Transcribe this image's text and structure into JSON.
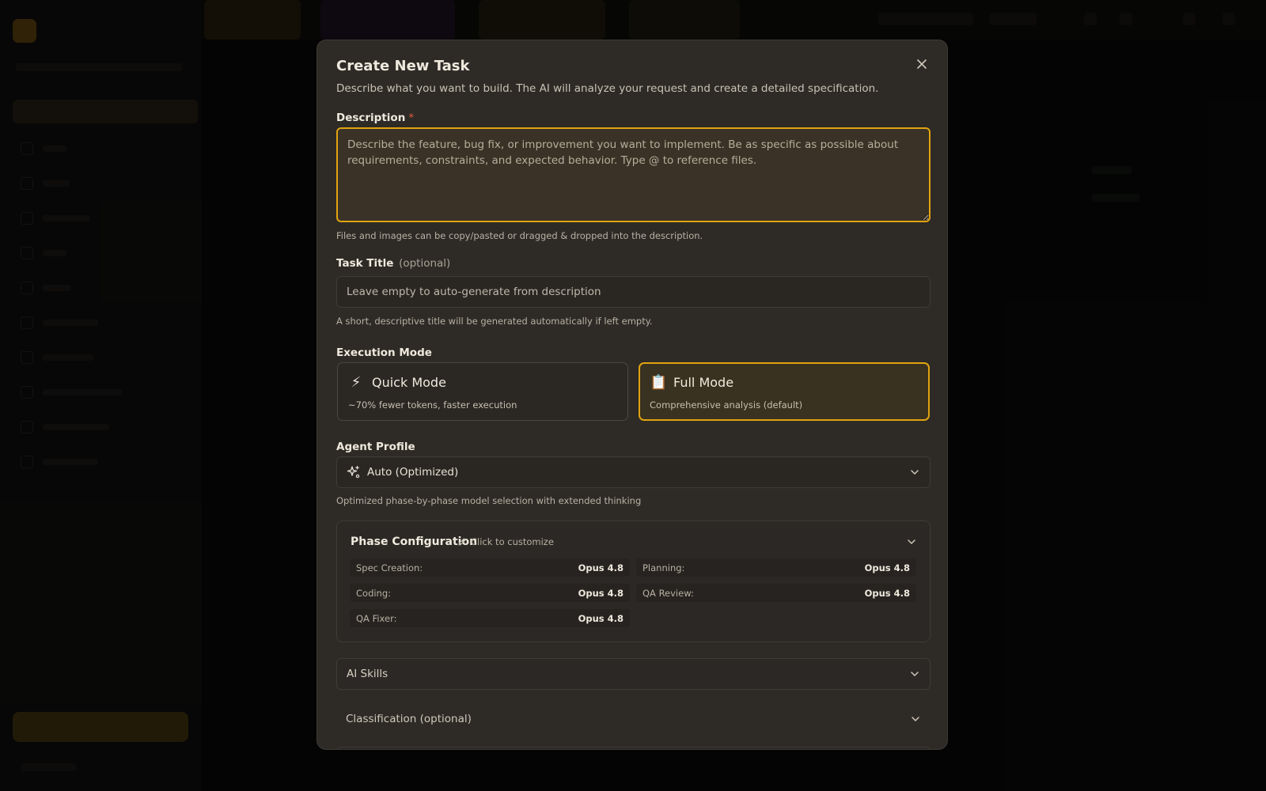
{
  "modal": {
    "title": "Create New Task",
    "subtitle": "Describe what you want to build. The AI will analyze your request and create a detailed specification.",
    "close_icon": "close-icon"
  },
  "description": {
    "label": "Description",
    "required_mark": "*",
    "placeholder": "Describe the feature, bug fix, or improvement you want to implement. Be as specific as possible about requirements, constraints, and expected behavior. Type @ to reference files.",
    "value": "",
    "help": "Files and images can be copy/pasted or dragged & dropped into the description."
  },
  "task_title": {
    "label": "Task Title",
    "optional": "(optional)",
    "placeholder": "Leave empty to auto-generate from description",
    "value": "",
    "help": "A short, descriptive title will be generated automatically if left empty."
  },
  "execution_mode": {
    "label": "Execution Mode",
    "selected": "full",
    "options": [
      {
        "id": "quick",
        "icon": "⚡",
        "icon_name": "lightning-icon",
        "title": "Quick Mode",
        "desc": "~70% fewer tokens, faster execution"
      },
      {
        "id": "full",
        "icon": "📋",
        "icon_name": "clipboard-icon",
        "title": "Full Mode",
        "desc": "Comprehensive analysis (default)"
      }
    ]
  },
  "agent_profile": {
    "label": "Agent Profile",
    "selected": "Auto (Optimized)",
    "icon_name": "sparkles-icon",
    "help": "Optimized phase-by-phase model selection with extended thinking"
  },
  "phase_config": {
    "title": "Phase Configuration",
    "customize_label": "Click to customize",
    "phases": [
      {
        "name": "Spec Creation:",
        "model": "Opus 4.8"
      },
      {
        "name": "Planning:",
        "model": "Opus 4.8"
      },
      {
        "name": "Coding:",
        "model": "Opus 4.8"
      },
      {
        "name": "QA Review:",
        "model": "Opus 4.8"
      },
      {
        "name": "QA Fixer:",
        "model": "Opus 4.8"
      }
    ]
  },
  "ai_skills": {
    "label": "AI Skills"
  },
  "classification": {
    "label": "Classification (optional)"
  },
  "colors": {
    "accent": "#e0a30f",
    "modal_bg": "#2e2b27",
    "required": "#e0573b"
  }
}
